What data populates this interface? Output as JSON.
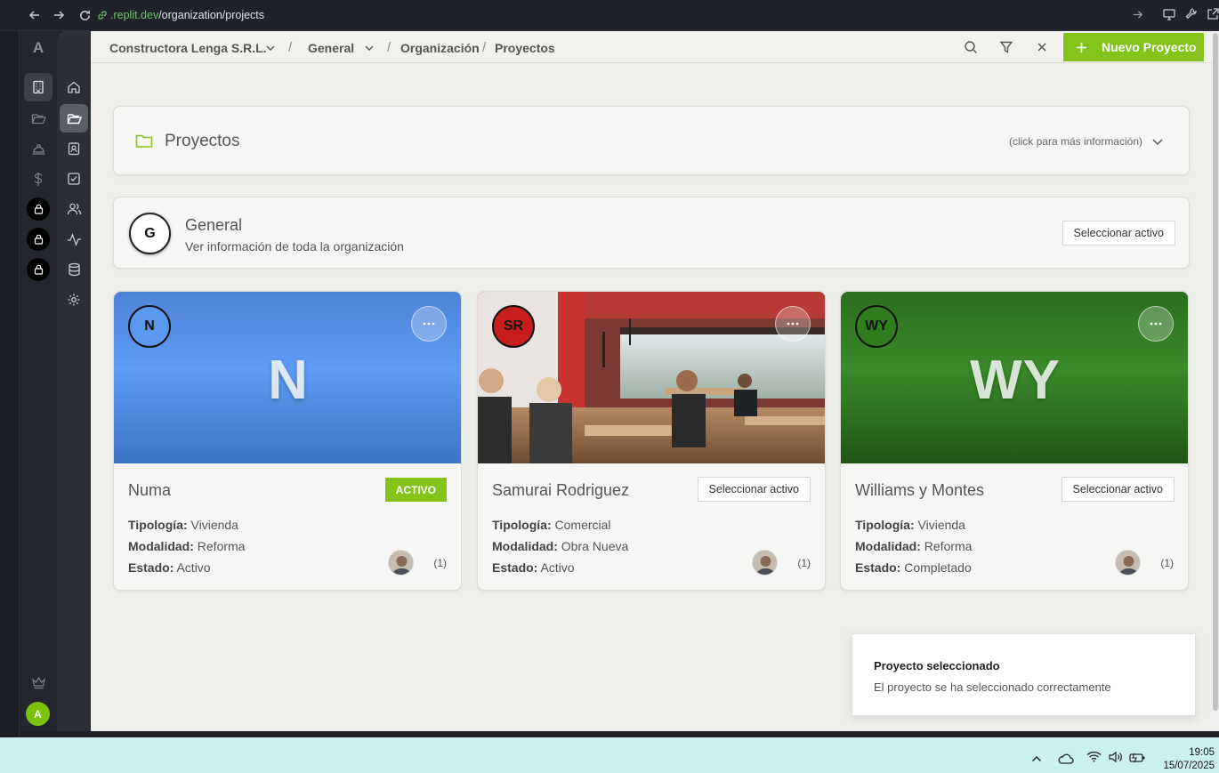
{
  "browser": {
    "url_host": ".replit.dev",
    "url_path": "/organization/projects"
  },
  "rail": {
    "logo": "A",
    "user_initial": "A"
  },
  "breadcrumb": {
    "company": "Constructora Lenga S.R.L.",
    "project": "General",
    "section": "Organización",
    "page": "Proyectos",
    "separator": "/"
  },
  "toolbar": {
    "new_project_label": "Nuevo Proyecto"
  },
  "info": {
    "title": "Proyectos",
    "hint": "(click para más información)"
  },
  "general": {
    "initial": "G",
    "title": "General",
    "subtitle": "Ver información de toda la organización",
    "select_label": "Seleccionar activo"
  },
  "labels": {
    "tipologia": "Tipología:",
    "modalidad": "Modalidad:",
    "estado": "Estado:"
  },
  "projects": [
    {
      "initials": "N",
      "name": "Numa",
      "tipologia": "Vivienda",
      "modalidad": "Reforma",
      "estado": "Activo",
      "members": "(1)",
      "status_badge": "ACTIVO",
      "cover": "blue gradient",
      "circle_color": "#5b98f0"
    },
    {
      "initials": "SR",
      "name": "Samurai Rodriguez",
      "tipologia": "Comercial",
      "modalidad": "Obra Nueva",
      "estado": "Activo",
      "members": "(1)",
      "select_label": "Seleccionar activo",
      "cover": "restaurant photo",
      "circle_color": "#c81d1d"
    },
    {
      "initials": "WY",
      "name": "Williams y Montes",
      "tipologia": "Vivienda",
      "modalidad": "Reforma",
      "estado": "Completado",
      "members": "(1)",
      "select_label": "Seleccionar activo",
      "cover": "green gradient",
      "circle_color": "#2f7d1e"
    }
  ],
  "toast": {
    "title": "Proyecto seleccionado",
    "message": "El proyecto se ha seleccionado correctamente"
  },
  "taskbar": {
    "time": "19:05",
    "date": "15/07/2025"
  },
  "colors": {
    "accent": "#84c41a",
    "background": "#efefec"
  }
}
